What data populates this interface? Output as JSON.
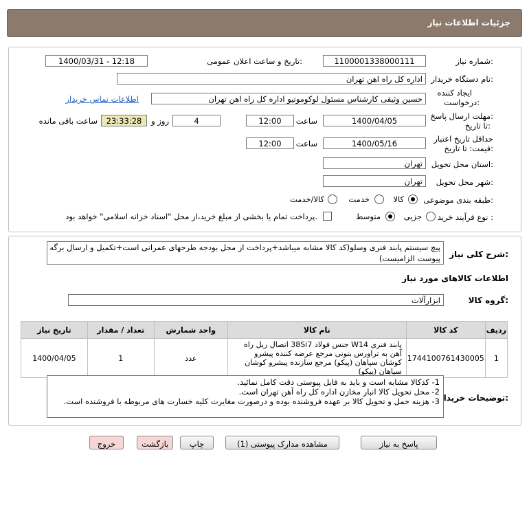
{
  "header": {
    "title": "جزئیات اطلاعات نیاز"
  },
  "form": {
    "need_number_label": "شماره نیاز:",
    "need_number": "1100001338000111",
    "announce_label": "تاریخ و ساعت اعلان عمومی:",
    "announce_value": "1400/03/31 - 12:18",
    "buyer_org_label": "نام دستگاه خریدار:",
    "buyer_org": "اداره کل راه اهن تهران",
    "creator_label_1": "ایجاد کننده",
    "creator_label_2": "درخواست:",
    "creator": "حسین وثیقی کارشناس مسئول لوکوموتیو اداره کل راه اهن تهران",
    "contact_link": "اطلاعات تماس خریدار",
    "deadline_label_1": "مهلت ارسال پاسخ:",
    "deadline_label_2": "تا تاریخ:",
    "deadline_date": "1400/04/05",
    "time_label": "ساعت",
    "deadline_time": "12:00",
    "days_value": "4",
    "days_and": "روز و",
    "remaining_time": "23:33:28",
    "remaining_label": "ساعت باقی مانده",
    "validity_label_1": "حداقل تاریخ اعتبار",
    "validity_label_2": "قیمت: تا تاریخ:",
    "validity_date": "1400/05/16",
    "validity_time": "12:00",
    "province_label": "استان محل تحویل:",
    "province": "تهران",
    "city_label": "شهر محل تحویل:",
    "city": "تهران",
    "category_label": "طبقه بندی موضوعی:",
    "category_options": [
      "کالا",
      "خدمت",
      "کالا/خدمت"
    ],
    "category_selected": "کالا",
    "process_label": "نوع فرآیند خرید :",
    "process_options": [
      "جزیی",
      "متوسط"
    ],
    "process_selected": "متوسط",
    "payment_note": "پرداخت تمام یا بخشی از مبلغ خرید،از محل \"اسناد خزانه اسلامی\" خواهد بود."
  },
  "summary": {
    "label": "شرح کلی نیاز:",
    "text": "پیچ سیستم پابند فنری وسلو(کد کالا مشابه میباشد+پرداخت از محل بودجه طرحهای عمرانی است+تکمیل و ارسال برگه پیوست الزامیست)"
  },
  "goods": {
    "section_title": "اطلاعات کالاهای مورد نیاز",
    "group_label": "گروه کالا:",
    "group_value": "ابزارآلات",
    "columns": [
      "ردیف",
      "کد کالا",
      "نام کالا",
      "واحد شمارش",
      "تعداد / مقدار",
      "تاریخ نیاز"
    ],
    "rows": [
      {
        "index": "1",
        "code": "1744100761430005",
        "name": "پابند فنری W14 جنس فولاد 38Si7 اتصال ریل راه آهن به تراورس بتونی مرجع عرضه کننده پیشرو کوشان سپاهان (پیکو) مرجع سازنده پیشرو کوشان سپاهان (پیکو)",
        "unit": "عدد",
        "qty": "1",
        "date": "1400/04/05"
      }
    ]
  },
  "notes": {
    "label": "توضیحات خریدار:",
    "lines": [
      "1- کدکالا مشابه است و باید به فایل پیوستی دقت کامل نمائید.",
      "2- محل تحویل کالا انبار مخازن اداره کل راه آهن تهران است.",
      "3- هزینه حمل و تحویل کالا بر عهده فروشنده بوده و درصورت مغایرت کلیه خسارت های مربوطه با فروشنده است."
    ]
  },
  "buttons": {
    "reply": "پاسخ به نیاز",
    "attachments": "مشاهده مدارک پیوستی (1)",
    "print": "چاپ",
    "back": "بازگشت",
    "exit": "خروج"
  }
}
